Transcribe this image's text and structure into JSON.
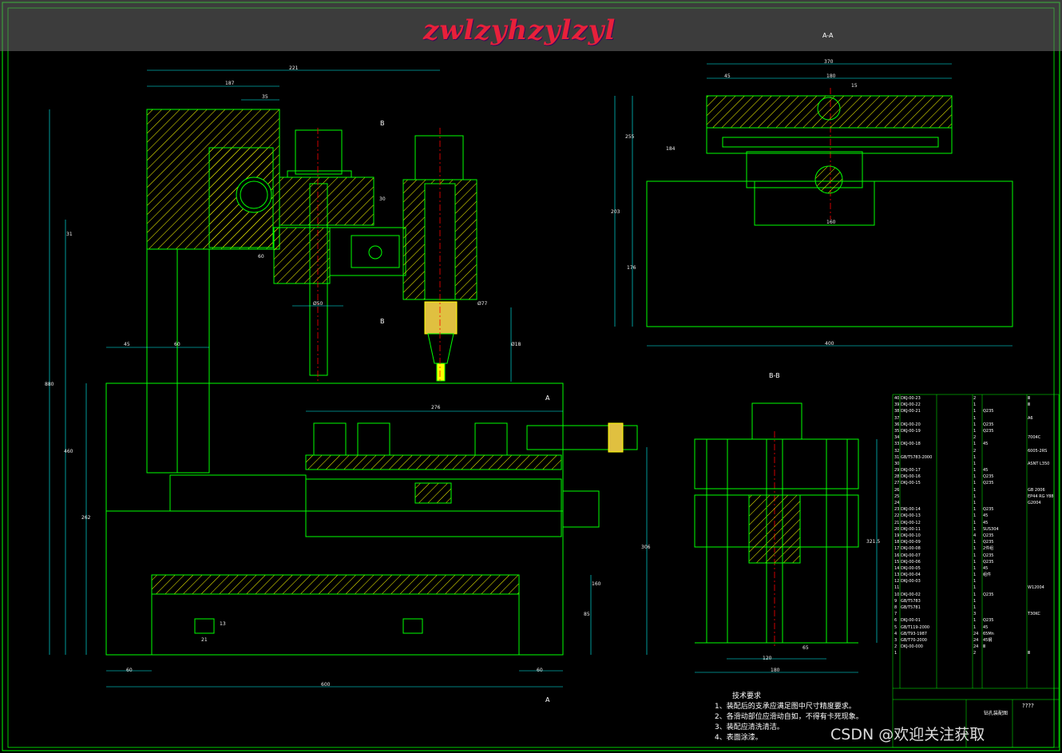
{
  "watermark": "zwlzyhzylzyl",
  "credit": "CSDN @欢迎关注获取",
  "views": {
    "section_aa": "A-A",
    "section_bb": "B-B",
    "cut_b": "B",
    "cut_a": "A"
  },
  "dimensions": {
    "main": [
      "221",
      "187",
      "35",
      "30",
      "31",
      "60",
      "Ø50",
      "Ø77",
      "Ø18",
      "45",
      "60",
      "276",
      "880",
      "460",
      "262",
      "160",
      "306",
      "85",
      "21",
      "13",
      "60",
      "60",
      "600"
    ],
    "section_aa": [
      "370",
      "45",
      "180",
      "15",
      "255",
      "184",
      "203",
      "176",
      "160",
      "400"
    ],
    "section_bb": [
      "321.5",
      "65",
      "120",
      "180"
    ]
  },
  "notes": {
    "title": "技术要求",
    "items": [
      "1、装配后的支承应满足图中尺寸精度要求。",
      "2、各滑动部位应滑动自如，不得有卡死现象。",
      "3、装配应清洗清洁。",
      "4、表面涂漆。"
    ]
  },
  "bom": {
    "rows": [
      [
        "40",
        "DKJ-00-23",
        "",
        "2",
        "",
        "Ⅲ"
      ],
      [
        "39",
        "DKJ-00-22",
        "",
        "1",
        "",
        "Ⅲ"
      ],
      [
        "38",
        "DKJ-00-21",
        "",
        "1",
        "Q235",
        ""
      ],
      [
        "37",
        "",
        "",
        "1",
        "",
        "A6"
      ],
      [
        "36",
        "DKJ-00-20",
        "",
        "1",
        "Q235",
        ""
      ],
      [
        "35",
        "DKJ-00-19",
        "",
        "1",
        "Q235",
        ""
      ],
      [
        "34",
        "",
        "",
        "2",
        "",
        "7004C"
      ],
      [
        "33",
        "DKJ-00-18",
        "",
        "1",
        "45",
        ""
      ],
      [
        "32",
        "",
        "",
        "2",
        "",
        "6005-2RS"
      ],
      [
        "31",
        "GB/T5783-2000",
        "",
        "1",
        "",
        ""
      ],
      [
        "30",
        "",
        "",
        "1",
        "",
        "ASNT L350"
      ],
      [
        "29",
        "DKJ-00-17",
        "",
        "1",
        "45",
        ""
      ],
      [
        "28",
        "DKJ-00-16",
        "",
        "1",
        "Q235",
        ""
      ],
      [
        "27",
        "DKJ-00-15",
        "",
        "1",
        "Q235",
        ""
      ],
      [
        "26",
        "",
        "",
        "1",
        "",
        "GB 2006"
      ],
      [
        "25",
        "",
        "",
        "1",
        "",
        "EP44 RG Y88"
      ],
      [
        "24",
        "",
        "",
        "1",
        "",
        "G2004"
      ],
      [
        "23",
        "DKJ-00-14",
        "",
        "1",
        "Q235",
        ""
      ],
      [
        "22",
        "DKJ-00-13",
        "",
        "1",
        "45",
        ""
      ],
      [
        "21",
        "DKJ-00-12",
        "",
        "1",
        "45",
        ""
      ],
      [
        "20",
        "DKJ-00-11",
        "",
        "1",
        "SUS304",
        ""
      ],
      [
        "19",
        "DKJ-00-10",
        "",
        "4",
        "Q235",
        ""
      ],
      [
        "18",
        "DKJ-00-09",
        "",
        "1",
        "Q235",
        ""
      ],
      [
        "17",
        "DKJ-00-08",
        "",
        "1",
        "2件组",
        ""
      ],
      [
        "16",
        "DKJ-00-07",
        "",
        "1",
        "Q235",
        ""
      ],
      [
        "15",
        "DKJ-00-06",
        "",
        "1",
        "Q235",
        ""
      ],
      [
        "14",
        "DKJ-00-05",
        "",
        "1",
        "45",
        ""
      ],
      [
        "13",
        "DKJ-00-04",
        "",
        "1",
        "组件",
        ""
      ],
      [
        "12",
        "DKJ-00-03",
        "",
        "1",
        "",
        ""
      ],
      [
        "11",
        "",
        "",
        "1",
        "",
        "W12004"
      ],
      [
        "10",
        "DKJ-00-02",
        "",
        "1",
        "Q235",
        ""
      ],
      [
        "9",
        "GB/T5783",
        "",
        "1",
        "",
        ""
      ],
      [
        "8",
        "GB/T5781",
        "",
        "1",
        "",
        ""
      ],
      [
        "7",
        "",
        "",
        "3",
        "",
        "T30KC"
      ],
      [
        "6",
        "DKJ-00-01",
        "",
        "1",
        "Q235",
        ""
      ],
      [
        "5",
        "GB/T119-2000",
        "",
        "1",
        "45",
        ""
      ],
      [
        "4",
        "GB/T93-1987",
        "",
        "24",
        "65Mn",
        ""
      ],
      [
        "3",
        "GB/T70-2000",
        "",
        "24",
        "45钢",
        ""
      ],
      [
        "2",
        "DKJ-00-000",
        "",
        "24",
        "Ⅲ",
        ""
      ],
      [
        "1",
        "",
        "",
        "2",
        "",
        "Ⅲ"
      ]
    ],
    "title_block": [
      "钻孔装配图",
      "????"
    ]
  },
  "colors": {
    "outline": "#00ff00",
    "hatch": "#ffff00",
    "center": "#ff0000",
    "dim": "#00ffff",
    "accent": "#ff00ff",
    "text": "#ffffff"
  }
}
